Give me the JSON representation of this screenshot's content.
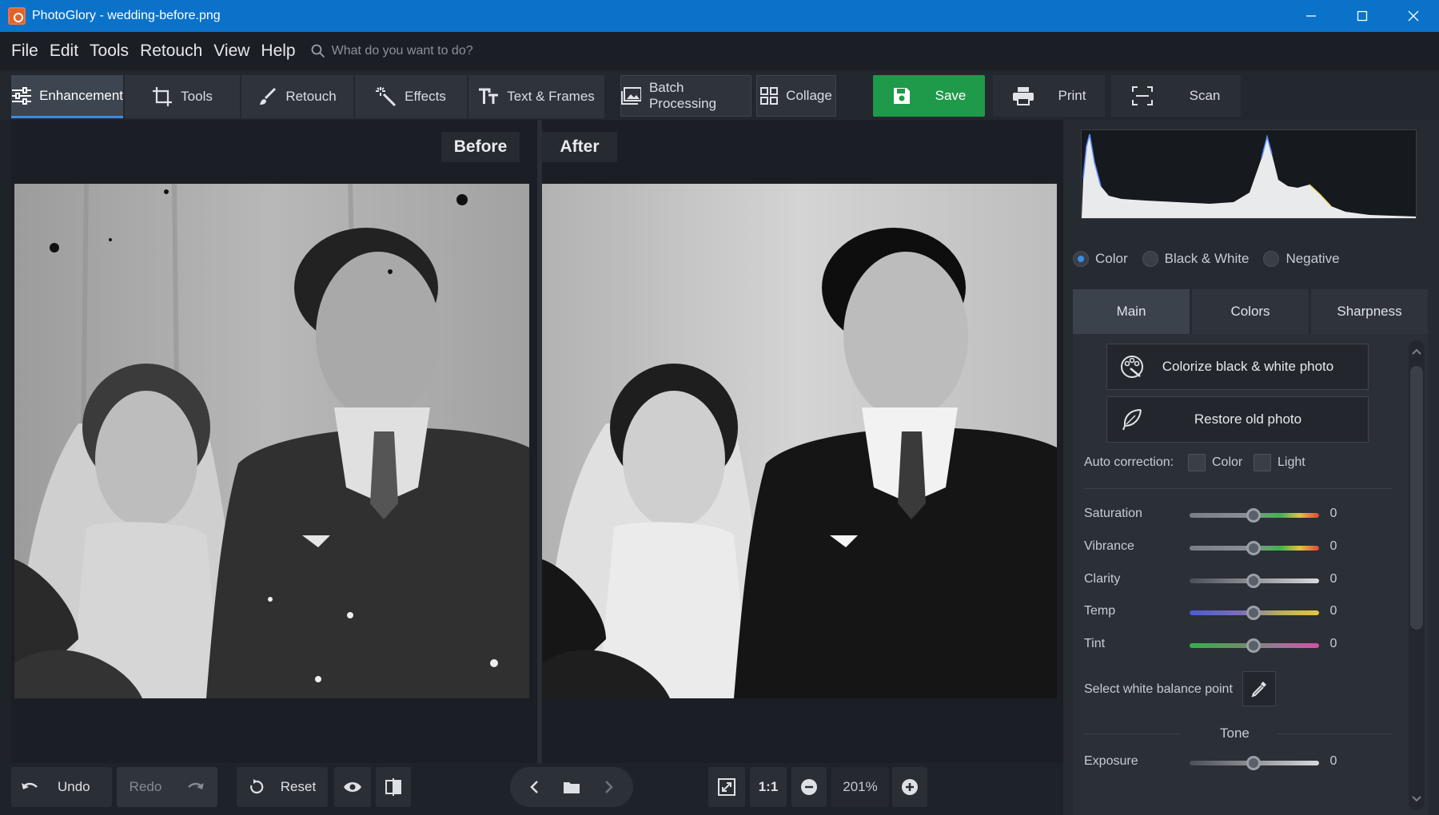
{
  "app": {
    "title": "PhotoGlory - wedding-before.png"
  },
  "menu": {
    "items": [
      "File",
      "Edit",
      "Tools",
      "Retouch",
      "View",
      "Help"
    ],
    "search_placeholder": "What do you want to do?"
  },
  "toolbar": {
    "tabs": [
      "Enhancement",
      "Tools",
      "Retouch",
      "Effects",
      "Text & Frames"
    ],
    "batch_label": "Batch Processing",
    "collage_label": "Collage",
    "save_label": "Save",
    "print_label": "Print",
    "scan_label": "Scan"
  },
  "canvas": {
    "before_label": "Before",
    "after_label": "After"
  },
  "bottom": {
    "undo_label": "Undo",
    "redo_label": "Redo",
    "reset_label": "Reset",
    "one_to_one": "1:1",
    "zoom": "201%"
  },
  "panel": {
    "modes": [
      "Color",
      "Black & White",
      "Negative"
    ],
    "selected_mode": "Color",
    "tabs": [
      "Main",
      "Colors",
      "Sharpness"
    ],
    "colorize_label": "Colorize black & white photo",
    "restore_label": "Restore old photo",
    "auto_correction_label": "Auto correction:",
    "auto_color_label": "Color",
    "auto_light_label": "Light",
    "sliders": [
      {
        "name": "Saturation",
        "value": "0"
      },
      {
        "name": "Vibrance",
        "value": "0"
      },
      {
        "name": "Clarity",
        "value": "0"
      },
      {
        "name": "Temp",
        "value": "0"
      },
      {
        "name": "Tint",
        "value": "0"
      }
    ],
    "white_balance_label": "Select white balance point",
    "tone_header": "Tone",
    "exposure": {
      "name": "Exposure",
      "value": "0"
    }
  },
  "colors": {
    "accent": "#3b8de4",
    "save_green": "#1f9a4a",
    "titlebar_blue": "#0a72c9"
  }
}
